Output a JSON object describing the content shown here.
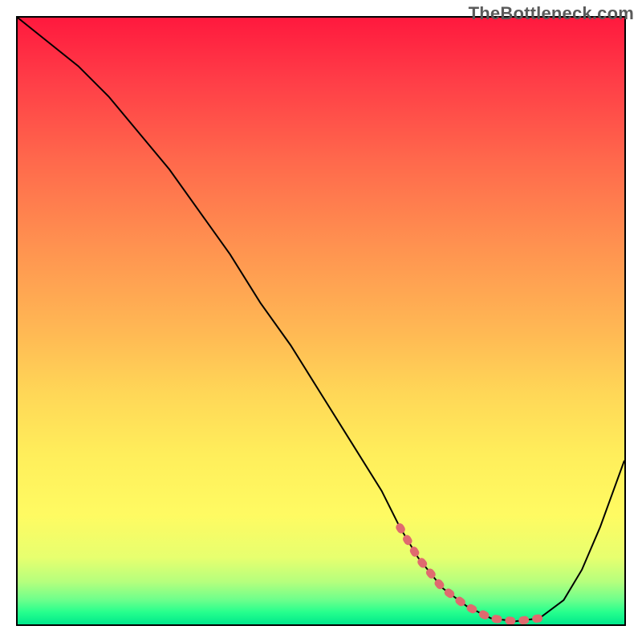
{
  "watermark": "TheBottleneck.com",
  "chart_data": {
    "type": "line",
    "title": "",
    "xlabel": "",
    "ylabel": "",
    "xlim": [
      0,
      100
    ],
    "ylim": [
      0,
      100
    ],
    "grid": false,
    "legend": false,
    "series": [
      {
        "name": "bottleneck-curve",
        "color": "#000000",
        "stroke_width": 2,
        "x": [
          0,
          5,
          10,
          15,
          20,
          25,
          30,
          35,
          40,
          45,
          50,
          55,
          60,
          63,
          66,
          70,
          74,
          78,
          82,
          86,
          90,
          93,
          96,
          100
        ],
        "y": [
          100,
          96,
          92,
          87,
          81,
          75,
          68,
          61,
          53,
          46,
          38,
          30,
          22,
          16,
          11,
          6,
          3,
          1,
          0.5,
          1,
          4,
          9,
          16,
          27
        ]
      },
      {
        "name": "optimal-range-highlight",
        "color": "#e06a6f",
        "stroke_width": 10,
        "dashed": true,
        "dash": "3 14",
        "x": [
          63,
          66,
          70,
          74,
          78,
          82,
          86
        ],
        "y": [
          16,
          11,
          6,
          3,
          1,
          0.5,
          1
        ]
      }
    ],
    "background_gradient": {
      "direction": "vertical",
      "stops": [
        {
          "pos": 0.0,
          "color": "#ff193e"
        },
        {
          "pos": 0.1,
          "color": "#ff3c47"
        },
        {
          "pos": 0.24,
          "color": "#ff6a4c"
        },
        {
          "pos": 0.38,
          "color": "#ff9350"
        },
        {
          "pos": 0.52,
          "color": "#ffb954"
        },
        {
          "pos": 0.62,
          "color": "#ffd757"
        },
        {
          "pos": 0.72,
          "color": "#ffee5b"
        },
        {
          "pos": 0.82,
          "color": "#fffb62"
        },
        {
          "pos": 0.89,
          "color": "#e7ff6f"
        },
        {
          "pos": 0.93,
          "color": "#b5ff7d"
        },
        {
          "pos": 0.96,
          "color": "#6cff8c"
        },
        {
          "pos": 0.98,
          "color": "#26ff8d"
        },
        {
          "pos": 1.0,
          "color": "#00e88c"
        }
      ]
    }
  }
}
